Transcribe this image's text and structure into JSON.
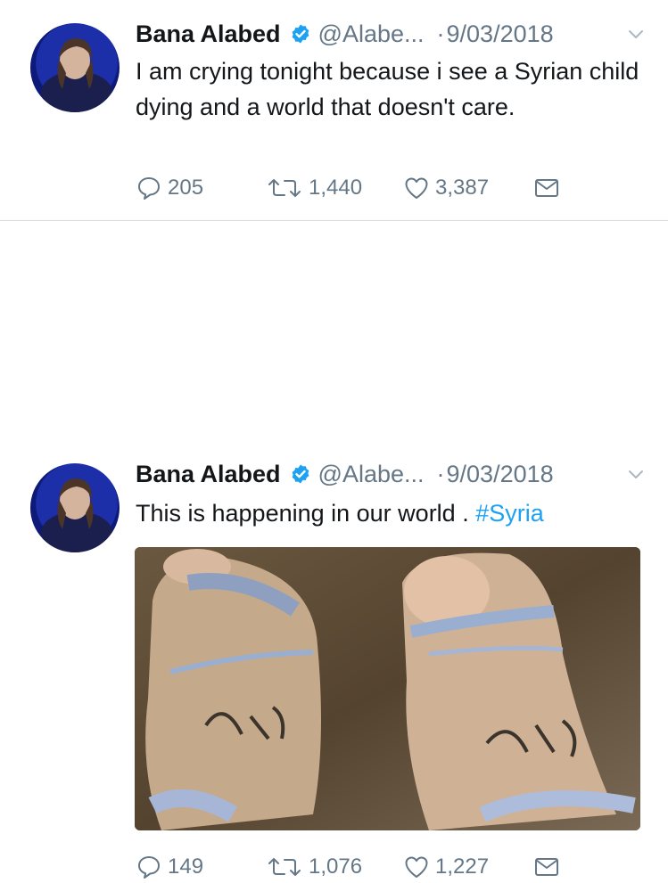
{
  "tweets": [
    {
      "name": "Bana Alabed",
      "handle": "@Alabe...",
      "dot": "·",
      "date": "9/03/2018",
      "text": "I am crying tonight because i see a Syrian child dying and a world that doesn't care.",
      "replies": "205",
      "retweets": "1,440",
      "likes": "3,387"
    },
    {
      "name": "Bana Alabed",
      "handle": "@Alabe...",
      "dot": "·",
      "date": "9/03/2018",
      "text": "This is happening in our world . ",
      "hashtag": "#Syria",
      "replies": "149",
      "retweets": "1,076",
      "likes": "1,227"
    }
  ],
  "colors": {
    "verified": "#1da1f2",
    "hashtag": "#1da1f2",
    "meta_text": "#657786",
    "divider": "#d8dde1"
  },
  "icons": [
    "verified-icon",
    "chevron-down-icon",
    "reply-icon",
    "retweet-icon",
    "like-icon",
    "direct-message-icon"
  ]
}
